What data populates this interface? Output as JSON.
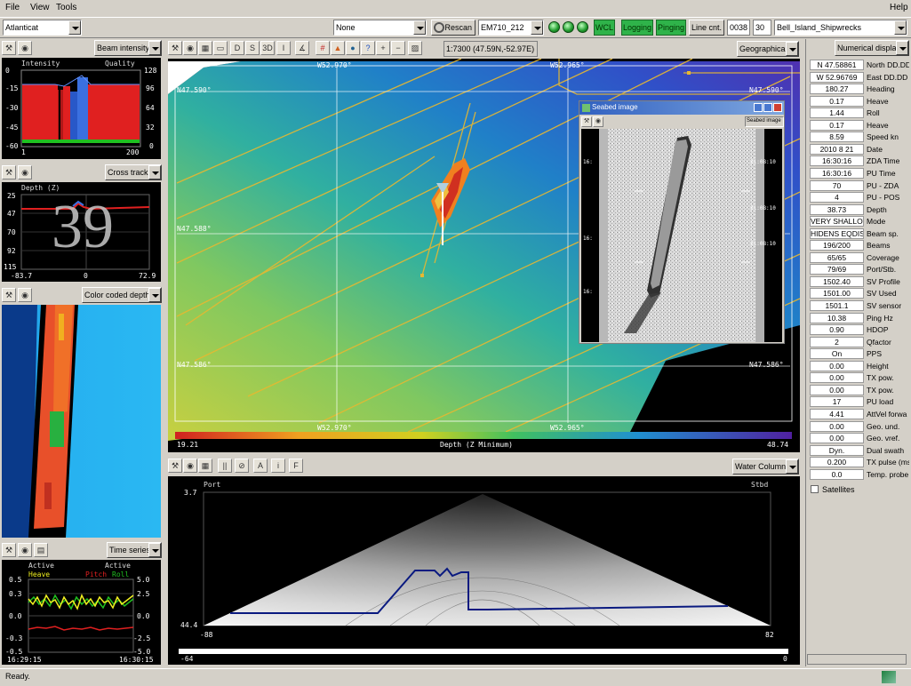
{
  "menu": {
    "file": "File",
    "view": "View",
    "tools": "Tools",
    "help": "Help"
  },
  "toolbar": {
    "project": "Atlanticat",
    "none": "None",
    "rescan": "Rescan",
    "sounder": "EM710_212",
    "wcl": "WCL",
    "logging": "Logging",
    "pinging": "Pinging",
    "linecnt": "Line cnt.",
    "line_no": "0038",
    "num": "30",
    "survey": "Bell_Island_Shipwrecks",
    "accent": "#2fb34a"
  },
  "left": {
    "beam": {
      "title": "Beam intensity",
      "intensity": "Intensity",
      "quality": "Quality",
      "yleft": [
        "0",
        "-15",
        "-30",
        "-45",
        "-60"
      ],
      "yright": [
        "128",
        "96",
        "64",
        "32",
        "0"
      ],
      "xmin": "1",
      "xmax": "200"
    },
    "cross": {
      "title": "Cross track",
      "depth_label": "Depth (Z)",
      "big": "39",
      "y": [
        "25",
        "47",
        "70",
        "92",
        "115"
      ],
      "x": [
        "-83.7",
        "0",
        "72.9"
      ]
    },
    "color": {
      "title": "Color coded depth"
    },
    "time": {
      "title": "Time series",
      "active1": "Active",
      "heave": "Heave",
      "active2": "Active",
      "pitch": "Pitch",
      "roll": "Roll",
      "yl": [
        "0.5",
        "0.3",
        "0.0",
        "-0.3",
        "-0.5"
      ],
      "yr": [
        "5.0",
        "2.5",
        "0.0",
        "-2.5",
        "-5.0"
      ],
      "t0": "16:29:15",
      "t1": "16:30:15"
    }
  },
  "center": {
    "scale": "1:7300 (47.59N,-52.97E)",
    "geo": "Geographical",
    "labels": {
      "w1": "W52.970°",
      "w2": "W52.965°",
      "n1": "N47.590°",
      "n2": "N47.588°",
      "n3": "N47.586°",
      "w3": "W52.970°",
      "w4": "W52.965°"
    },
    "depth_min": "19.21",
    "depth_title": "Depth (Z Minimum)",
    "depth_max": "48.74",
    "seabed": {
      "title": "Seabed image",
      "combo": "Seabed image",
      "ticks": [
        "16:",
        "21:08:10",
        "16:",
        "21:08:10",
        "16:",
        "21:08:10"
      ]
    },
    "wc": {
      "title": "Water Column",
      "port": "Port",
      "stbd": "Stbd",
      "ytop": "3.7",
      "ybot": "44.4",
      "xl": "-88",
      "xr": "82",
      "sl": "-64",
      "sr": "0"
    }
  },
  "numeric": {
    "title": "Numerical display",
    "rows": [
      [
        "N 47.58861",
        "North DD.DD"
      ],
      [
        "W 52.96769",
        "East DD.DD"
      ],
      [
        "180.27",
        "Heading"
      ],
      [
        "0.17",
        "Heave"
      ],
      [
        "1.44",
        "Roll"
      ],
      [
        "0.17",
        "Heave"
      ],
      [
        "8.59",
        "Speed kn"
      ],
      [
        "2010 8 21",
        "Date"
      ],
      [
        "16:30:16",
        "ZDA Time"
      ],
      [
        "16:30:16",
        "PU Time"
      ],
      [
        "70",
        "PU - ZDA"
      ],
      [
        "4",
        "PU - POS"
      ],
      [
        "38.73",
        "Depth"
      ],
      [
        "VERY SHALLOW",
        "Mode"
      ],
      [
        "HIDENS EQDIST",
        "Beam sp."
      ],
      [
        "196/200",
        "Beams"
      ],
      [
        "65/65",
        "Coverage"
      ],
      [
        "79/69",
        "Port/Stb."
      ],
      [
        "1502.40",
        "SV Profile"
      ],
      [
        "1501.00",
        "SV Used"
      ],
      [
        "1501.1",
        "SV sensor"
      ],
      [
        "10.38",
        "Ping Hz"
      ],
      [
        "0.90",
        "HDOP"
      ],
      [
        "2",
        "Qfactor"
      ],
      [
        "On",
        "PPS"
      ],
      [
        "0.00",
        "Height"
      ],
      [
        "0.00",
        "TX pow."
      ],
      [
        "0.00",
        "TX pow."
      ],
      [
        "17",
        "PU load"
      ],
      [
        "4.41",
        "AttVel forwa"
      ],
      [
        "0.00",
        "Geo. und."
      ],
      [
        "0.00",
        "Geo. vref."
      ],
      [
        "Dyn.",
        "Dual swath"
      ],
      [
        "0.200",
        "TX pulse (ms"
      ],
      [
        "0.0",
        "Temp. probe"
      ]
    ],
    "satellites": "Satellites"
  },
  "status": {
    "text": "Ready."
  }
}
